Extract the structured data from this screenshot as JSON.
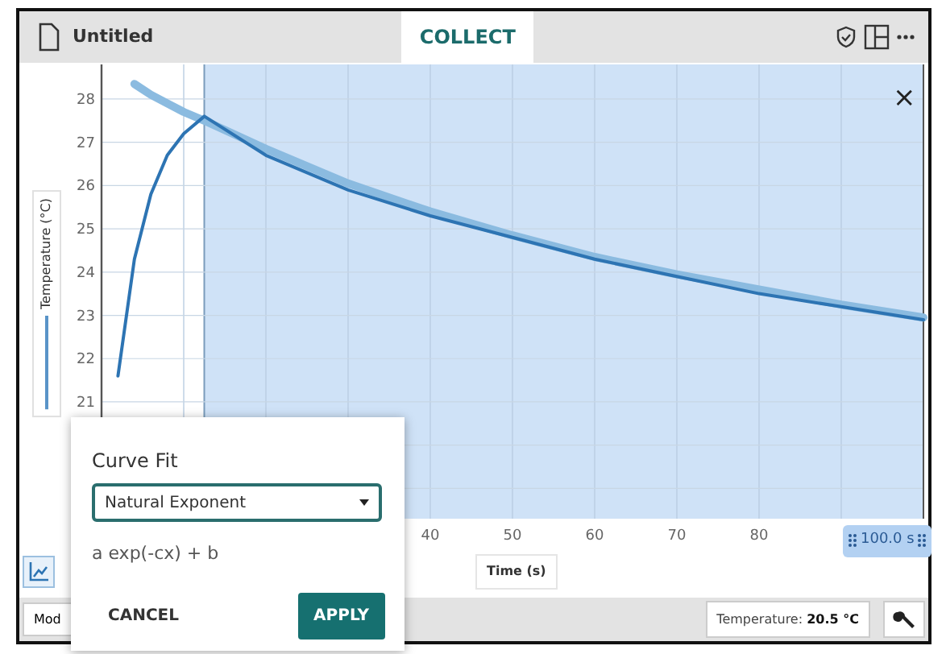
{
  "title_bar": {
    "document_title": "Untitled",
    "tab": {
      "label": "COLLECT",
      "selected": true
    }
  },
  "graph": {
    "selection_label": "100.0 s",
    "close_symbol": "×",
    "chart_data": {
      "type": "line",
      "xlabel": "Time (s)",
      "ylabel": "Temperature (°C)",
      "xlim": [
        0,
        100
      ],
      "ylim": [
        18.3,
        28.8
      ],
      "grid": true,
      "xticks": [
        40,
        50,
        60,
        70,
        80
      ],
      "yticks": [
        21,
        22,
        23,
        24,
        25,
        26,
        27,
        28
      ],
      "x": [
        2,
        4,
        6,
        8,
        10,
        12.5,
        20,
        30,
        40,
        50,
        60,
        70,
        80,
        90,
        100
      ],
      "series": [
        {
          "color": "#8bbbe0",
          "values": [
            null,
            28.35,
            28.1,
            27.9,
            27.7,
            27.5,
            26.85,
            26.05,
            25.4,
            24.85,
            24.35,
            23.95,
            23.6,
            23.25,
            22.95
          ]
        },
        {
          "color": "#2d74b3",
          "values": [
            21.6,
            24.3,
            25.8,
            26.7,
            27.2,
            27.6,
            26.7,
            25.9,
            25.3,
            24.8,
            24.3,
            23.9,
            23.5,
            23.2,
            22.9
          ]
        }
      ]
    }
  },
  "curve_fit_dialog": {
    "title": "Curve Fit",
    "model": "Natural Exponent",
    "formula": "a exp(-cx) + b",
    "buttons": [
      {
        "label": "CANCEL",
        "kind": "text"
      },
      {
        "label": "APPLY",
        "kind": "primary"
      }
    ]
  },
  "bottom_bar": {
    "mode_button": "Mod",
    "sensor_reading": "Temperature: **20.5 °C**"
  }
}
